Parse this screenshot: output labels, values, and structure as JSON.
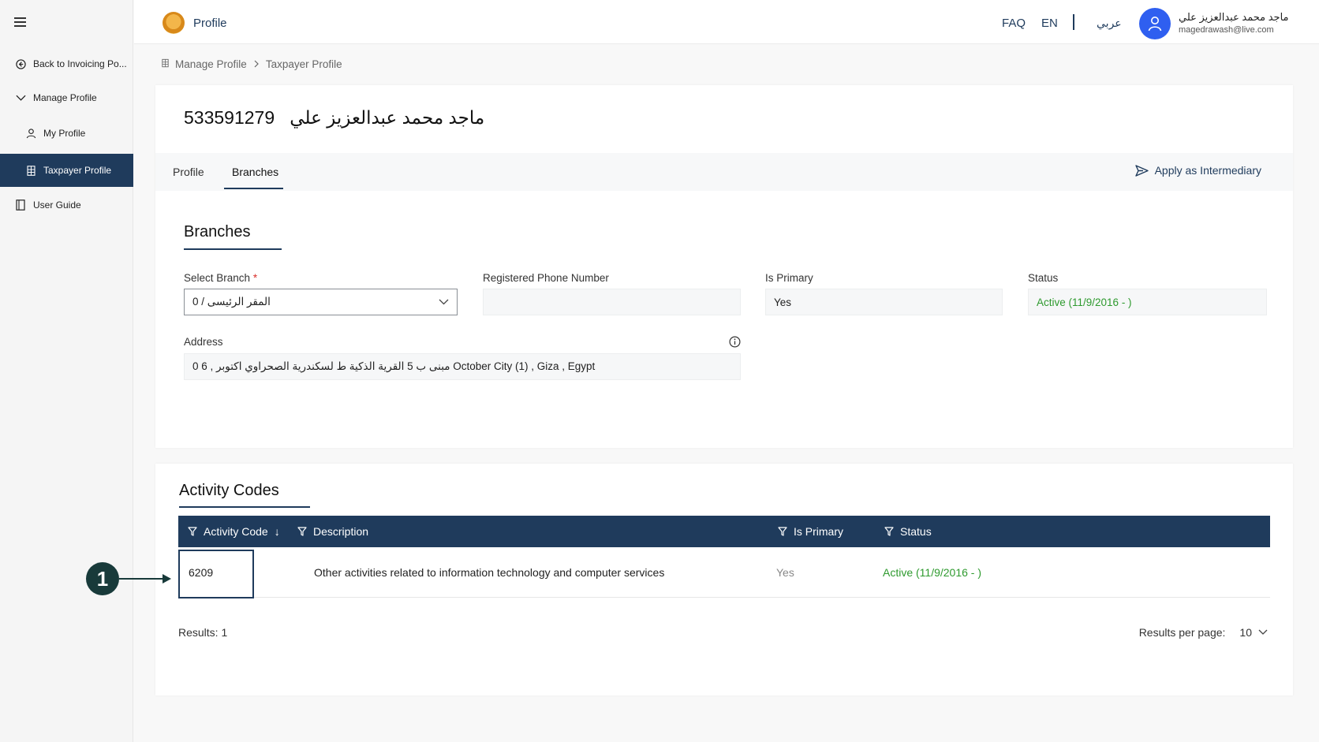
{
  "sidebar": {
    "items": [
      {
        "label": "Back to Invoicing Po..."
      },
      {
        "label": "Manage Profile"
      },
      {
        "label": "My Profile"
      },
      {
        "label": "Taxpayer Profile"
      },
      {
        "label": "User Guide"
      }
    ]
  },
  "header": {
    "app_title": "Profile",
    "faq": "FAQ",
    "lang_en": "EN",
    "lang_ar": "عربي",
    "user_name": "ماجد محمد عبدالعزيز علي",
    "user_email": "magedrawash@live.com"
  },
  "breadcrumb": {
    "items": [
      "Manage Profile",
      "Taxpayer Profile"
    ]
  },
  "page": {
    "title_number": "533591279",
    "title_name": "ماجد محمد عبدالعزيز علي"
  },
  "tabs": {
    "items": [
      "Profile",
      "Branches"
    ],
    "active": "Branches",
    "apply_label": "Apply as Intermediary"
  },
  "branches": {
    "section_title": "Branches",
    "select_branch_label": "Select Branch",
    "required_mark": "*",
    "select_branch_value": "0 / المقر الرئيسى",
    "phone_label": "Registered Phone Number",
    "phone_value": "",
    "is_primary_label": "Is Primary",
    "is_primary_value": "Yes",
    "status_label": "Status",
    "status_value": "Active (11/9/2016 - )",
    "address_label": "Address",
    "address_value": "0  6 , مبنى ب 5 القرية الذكية ط لسكندرية الصحراوي اكتوبر October City (1) , Giza , Egypt"
  },
  "activity_codes": {
    "section_title": "Activity Codes",
    "columns": [
      "Activity Code",
      "Description",
      "Is Primary",
      "Status"
    ],
    "sort_indicator": "↓",
    "rows": [
      {
        "code": "6209",
        "description": "Other activities related to information technology and computer services",
        "is_primary": "Yes",
        "status": "Active (11/9/2016 - )"
      }
    ],
    "results_text": "Results: 1",
    "per_page_label": "Results per page:",
    "per_page_value": "10"
  },
  "annotation": {
    "number": "1"
  },
  "colors": {
    "primary": "#1f3b5c",
    "status_green": "#2e9a2e",
    "required_red": "#d9302c",
    "avatar_blue": "#2f5ff0"
  }
}
